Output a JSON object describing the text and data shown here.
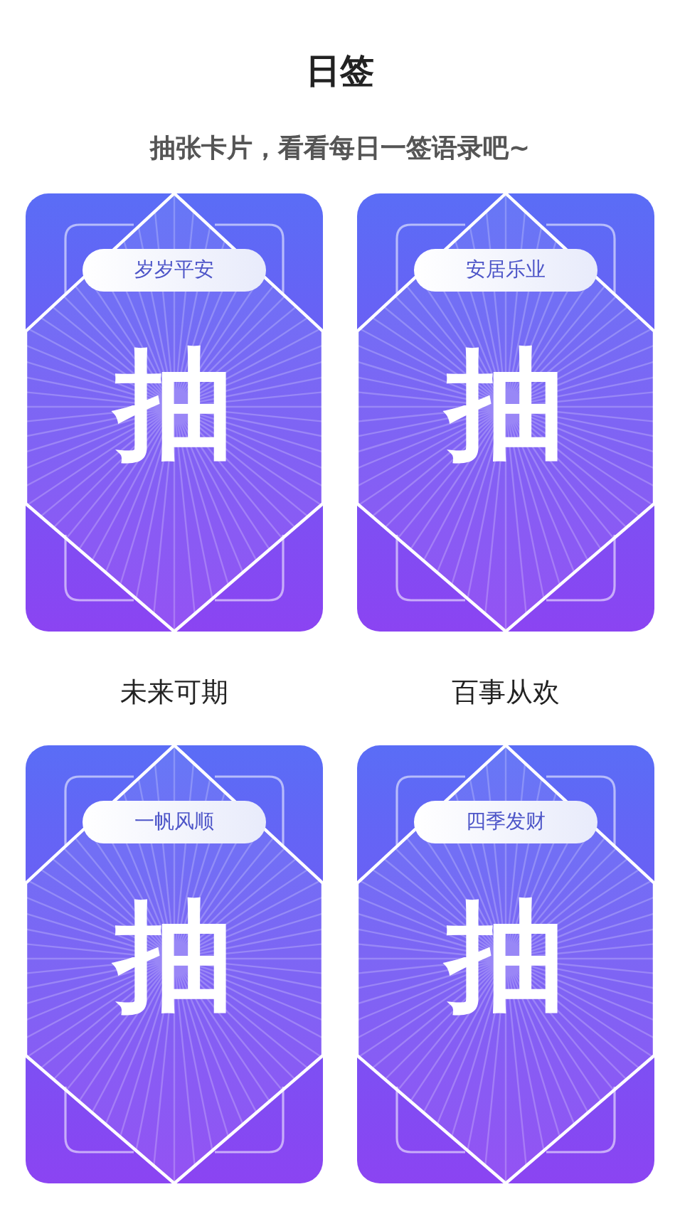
{
  "title": "日签",
  "subtitle": "抽张卡片，看看每日一签语录吧~",
  "cards": [
    {
      "tag": "岁岁平安",
      "glyph": "抽",
      "caption": "未来可期"
    },
    {
      "tag": "安居乐业",
      "glyph": "抽",
      "caption": "百事从欢"
    },
    {
      "tag": "一帆风顺",
      "glyph": "抽"
    },
    {
      "tag": "四季发财",
      "glyph": "抽"
    }
  ]
}
